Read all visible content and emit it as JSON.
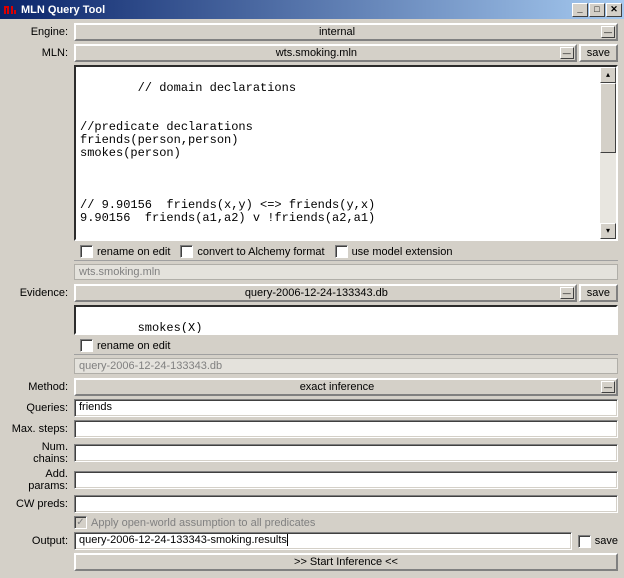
{
  "window": {
    "title": "MLN Query Tool"
  },
  "labels": {
    "engine": "Engine:",
    "mln": "MLN:",
    "evidence": "Evidence:",
    "method": "Method:",
    "queries": "Queries:",
    "maxsteps": "Max. steps:",
    "numchains": "Num. chains:",
    "addparams": "Add. params:",
    "cwpreds": "CW preds:",
    "output": "Output:"
  },
  "buttons": {
    "save": "save",
    "start": ">> Start Inference <<"
  },
  "engine": {
    "value": "internal"
  },
  "mln": {
    "file": "wts.smoking.mln",
    "content": "// domain declarations\n\n\n//predicate declarations\nfriends(person,person)\nsmokes(person)\n\n\n\n// 9.90156  friends(x,y) <=> friends(y,x)\n9.90156  friends(a1,a2) v !friends(a2,a1)",
    "checks": {
      "rename": "rename on edit",
      "convert": "convert to Alchemy format",
      "usemodel": "use model extension"
    },
    "path": "wts.smoking.mln"
  },
  "evidence": {
    "file": "query-2006-12-24-133343.db",
    "content": "smokes(X)\nsmokes(Y)",
    "checks": {
      "rename": "rename on edit"
    },
    "path": "query-2006-12-24-133343.db"
  },
  "method": {
    "value": "exact inference"
  },
  "queries": {
    "value": "friends"
  },
  "maxsteps": {
    "value": ""
  },
  "numchains": {
    "value": ""
  },
  "addparams": {
    "value": ""
  },
  "cwpreds": {
    "value": ""
  },
  "openworld": {
    "label": "Apply open-world assumption to all predicates"
  },
  "output": {
    "value": "query-2006-12-24-133343-smoking.results"
  }
}
